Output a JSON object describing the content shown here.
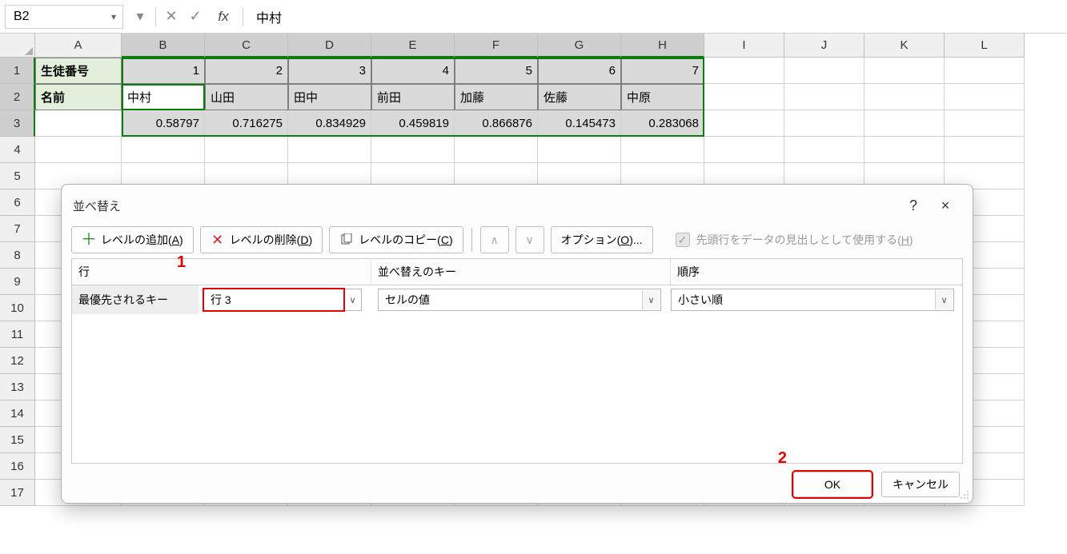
{
  "formula_bar": {
    "name_box": "B2",
    "fx_label": "fx",
    "formula_value": "中村"
  },
  "grid": {
    "column_letters": [
      "A",
      "B",
      "C",
      "D",
      "E",
      "F",
      "G",
      "H",
      "I",
      "J",
      "K",
      "L"
    ],
    "selected_cols": [
      "B",
      "C",
      "D",
      "E",
      "F",
      "G",
      "H"
    ],
    "row_numbers": [
      "1",
      "2",
      "3",
      "4",
      "5",
      "6",
      "7",
      "8",
      "9",
      "10",
      "11",
      "12",
      "13",
      "14",
      "15",
      "16",
      "17"
    ],
    "selected_rows": [
      "1",
      "2",
      "3"
    ],
    "row1": {
      "A": "生徒番号",
      "B": "1",
      "C": "2",
      "D": "3",
      "E": "4",
      "F": "5",
      "G": "6",
      "H": "7"
    },
    "row2": {
      "A": "名前",
      "B": "中村",
      "C": "山田",
      "D": "田中",
      "E": "前田",
      "F": "加藤",
      "G": "佐藤",
      "H": "中原"
    },
    "row3": {
      "A": "",
      "B": "0.58797",
      "C": "0.716275",
      "D": "0.834929",
      "E": "0.459819",
      "F": "0.866876",
      "G": "0.145473",
      "H": "0.283068"
    }
  },
  "dialog": {
    "title": "並べ替え",
    "help_aria": "?",
    "close_aria": "×",
    "buttons": {
      "add_level": "レベルの追加(A)",
      "delete_level": "レベルの削除(D)",
      "copy_level": "レベルのコピー(C)",
      "options": "オプション(O)..."
    },
    "checkbox_label": "先頭行をデータの見出しとして使用する(H)",
    "headers": {
      "col": "行",
      "sort_on": "並べ替えのキー",
      "order": "順序"
    },
    "level": {
      "label": "最優先されるキー",
      "column_value": "行 3",
      "sort_on_value": "セルの値",
      "order_value": "小さい順"
    },
    "footer": {
      "ok": "OK",
      "cancel": "キャンセル"
    }
  },
  "annotations": {
    "marker1": "1",
    "marker2": "2"
  }
}
